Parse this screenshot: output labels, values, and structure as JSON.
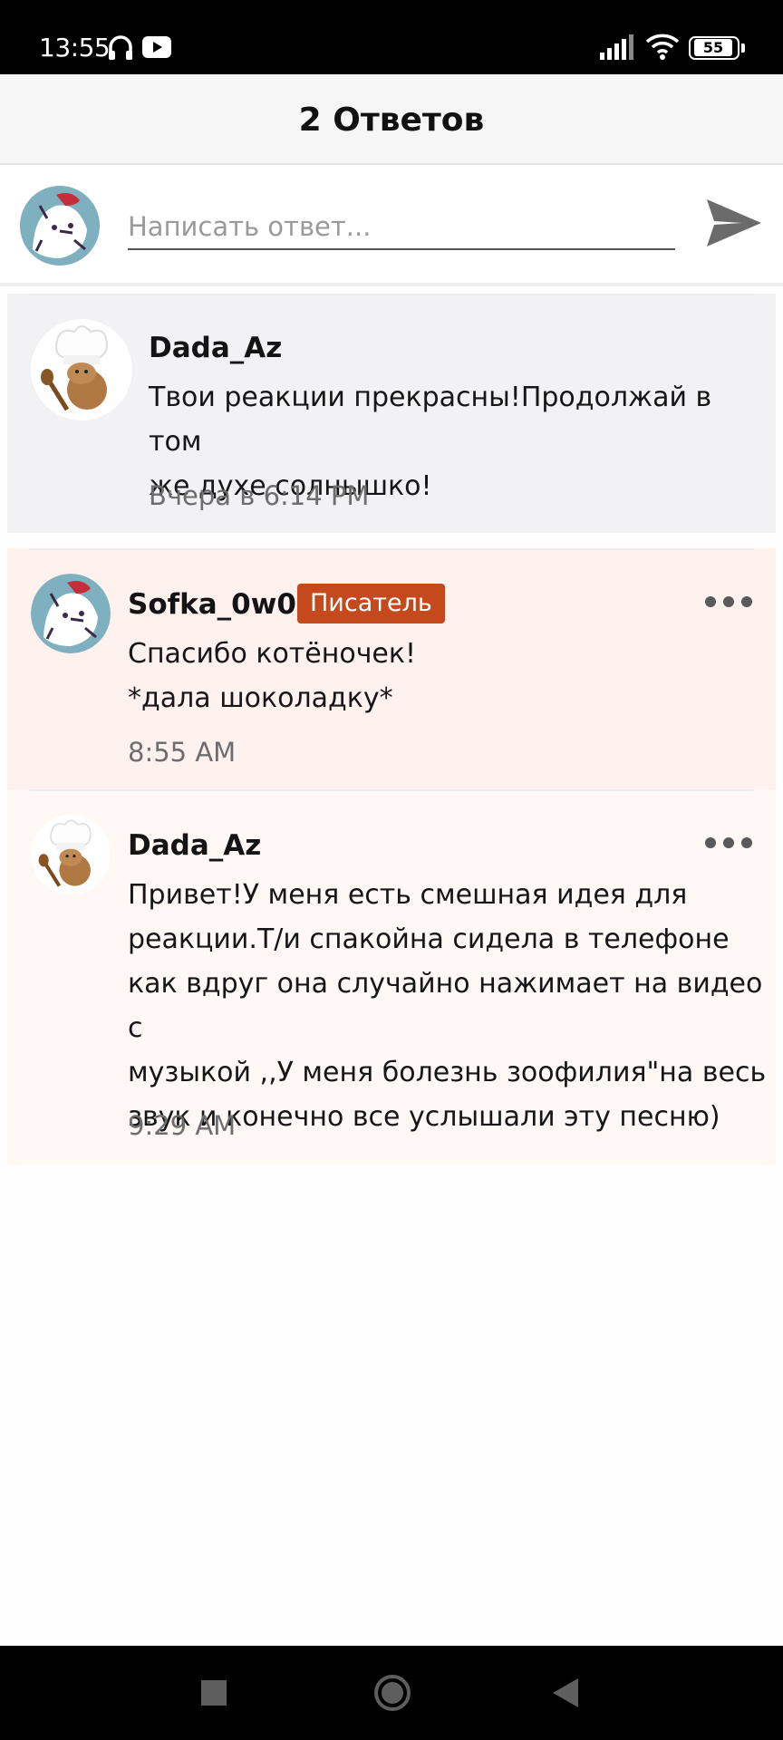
{
  "status_bar": {
    "time": "13:55",
    "battery": "55",
    "icons": [
      "headphones-icon",
      "youtube-icon",
      "signal-icon",
      "wifi-icon",
      "battery-icon"
    ]
  },
  "header": {
    "title": "2 Ответов"
  },
  "reply": {
    "placeholder": "Написать ответ...",
    "send_icon": "send-icon"
  },
  "comments": [
    {
      "username": "Dada_Az",
      "text": "Твои реакции прекрасны!Продолжай в том\nже духе солнышко!",
      "time": "Вчера в 6:14 PM",
      "avatar": "chef-cat-avatar"
    },
    {
      "username": "Sofka_0w0",
      "badge": "Писатель",
      "text": "Спасибо котёночек!\n*дала шоколадку*",
      "time": "8:55 AM",
      "avatar": "drawn-cat-avatar"
    },
    {
      "username": "Dada_Az",
      "text": "Привет!У меня есть смешная идея для\nреакции.Т/и спакойна сидела в телефоне\nкак вдруг она случайно нажимает на видео с\nмузыкой ,,У меня болезнь зоофилия\"на весь\nзвук и конечно все услышали эту песню)",
      "time": "9:29 AM",
      "avatar": "chef-cat-avatar"
    }
  ],
  "colors": {
    "highlight_bg": "#f2f2f5",
    "own_reply_bg": "#fff2ee",
    "reply_bg": "#fff8f4",
    "badge_bg": "#c4491c"
  },
  "nav_bar": {
    "icons": [
      "recent-apps-icon",
      "home-icon",
      "back-icon"
    ]
  }
}
